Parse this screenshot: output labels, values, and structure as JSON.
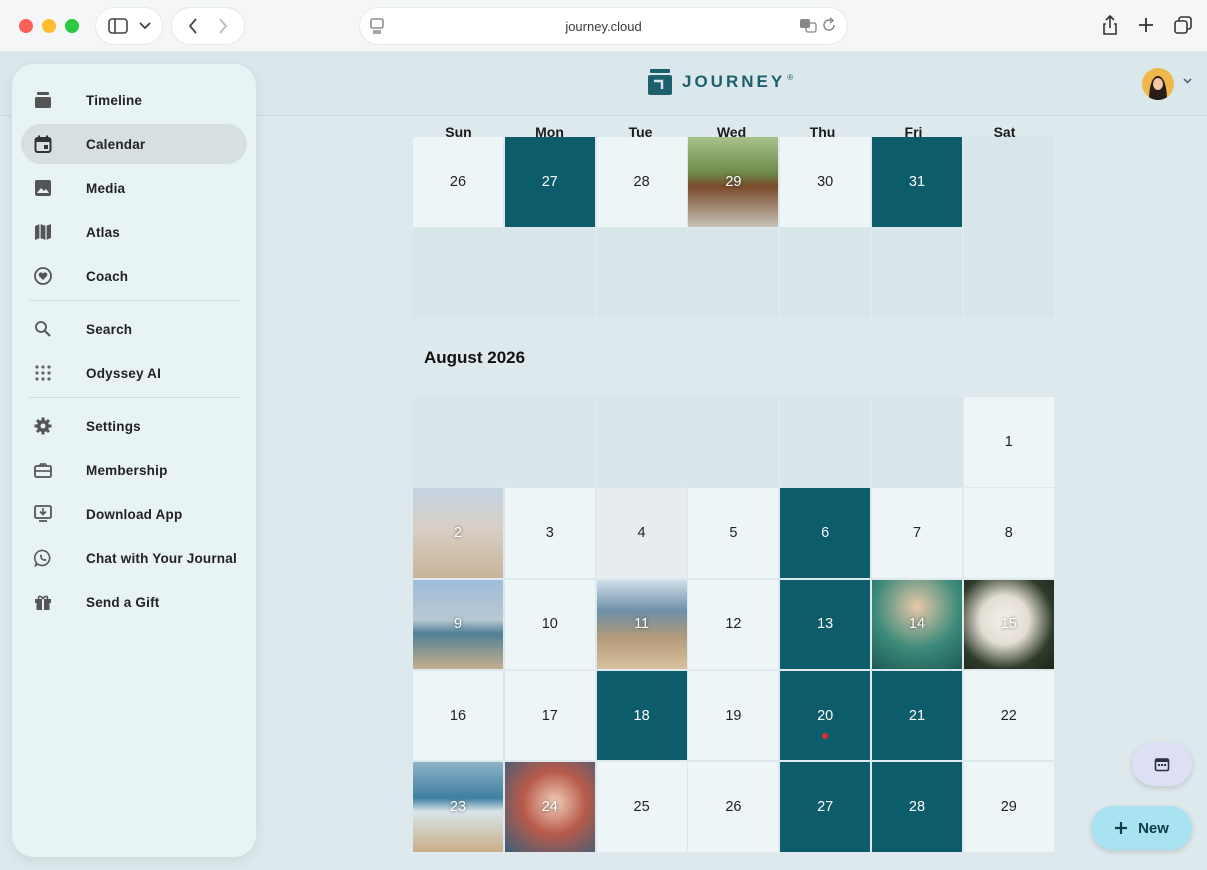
{
  "browser": {
    "url": "journey.cloud"
  },
  "app": {
    "brand": "JOURNEY",
    "brand_mark": "®"
  },
  "sidebar": {
    "items": [
      {
        "label": "Timeline",
        "icon": "timeline-icon"
      },
      {
        "label": "Calendar",
        "icon": "calendar-icon",
        "active": true
      },
      {
        "label": "Media",
        "icon": "image-icon"
      },
      {
        "label": "Atlas",
        "icon": "map-icon"
      },
      {
        "label": "Coach",
        "icon": "heart-icon"
      },
      {
        "label": "Search",
        "icon": "search-icon"
      },
      {
        "label": "Odyssey AI",
        "icon": "dots-grid-icon"
      },
      {
        "label": "Settings",
        "icon": "gear-icon"
      },
      {
        "label": "Membership",
        "icon": "membership-card-icon"
      },
      {
        "label": "Download App",
        "icon": "download-monitor-icon"
      },
      {
        "label": "Chat with Your Journal",
        "icon": "whatsapp-icon"
      },
      {
        "label": "Send a Gift",
        "icon": "gift-icon"
      }
    ]
  },
  "calendar": {
    "weekdays": [
      "Sun",
      "Mon",
      "Tue",
      "Wed",
      "Thu",
      "Fri",
      "Sat"
    ],
    "july_tail": [
      {
        "day": "26",
        "style": "plain"
      },
      {
        "day": "27",
        "style": "teal"
      },
      {
        "day": "28",
        "style": "plain"
      },
      {
        "day": "29",
        "style": "photo-horse"
      },
      {
        "day": "30",
        "style": "plain"
      },
      {
        "day": "31",
        "style": "teal"
      },
      {
        "day": "",
        "style": "empty"
      }
    ],
    "month_title": "August 2026",
    "august": [
      {
        "day": "",
        "style": "empty"
      },
      {
        "day": "",
        "style": "empty"
      },
      {
        "day": "",
        "style": "empty"
      },
      {
        "day": "",
        "style": "empty"
      },
      {
        "day": "",
        "style": "empty"
      },
      {
        "day": "",
        "style": "empty"
      },
      {
        "day": "1",
        "style": "plain"
      },
      {
        "day": "2",
        "style": "photo-beach"
      },
      {
        "day": "3",
        "style": "plain"
      },
      {
        "day": "4",
        "style": "grayish"
      },
      {
        "day": "5",
        "style": "plain"
      },
      {
        "day": "6",
        "style": "teal"
      },
      {
        "day": "7",
        "style": "plain"
      },
      {
        "day": "8",
        "style": "plain"
      },
      {
        "day": "9",
        "style": "photo-girl"
      },
      {
        "day": "10",
        "style": "plain"
      },
      {
        "day": "11",
        "style": "photo-shore"
      },
      {
        "day": "12",
        "style": "plain"
      },
      {
        "day": "13",
        "style": "teal"
      },
      {
        "day": "14",
        "style": "photo-icecream"
      },
      {
        "day": "15",
        "style": "photo-dog"
      },
      {
        "day": "16",
        "style": "plain"
      },
      {
        "day": "17",
        "style": "plain"
      },
      {
        "day": "18",
        "style": "teal"
      },
      {
        "day": "19",
        "style": "plain"
      },
      {
        "day": "20",
        "style": "teal",
        "dot": true
      },
      {
        "day": "21",
        "style": "teal"
      },
      {
        "day": "22",
        "style": "plain"
      },
      {
        "day": "23",
        "style": "photo-wave"
      },
      {
        "day": "24",
        "style": "photo-kids"
      },
      {
        "day": "25",
        "style": "plain"
      },
      {
        "day": "26",
        "style": "plain"
      },
      {
        "day": "27",
        "style": "teal"
      },
      {
        "day": "28",
        "style": "teal"
      },
      {
        "day": "29",
        "style": "plain"
      }
    ]
  },
  "fab": {
    "new_label": "New"
  },
  "colors": {
    "accent_teal": "#0c5c6b",
    "new_button": "#a9e3f2",
    "calendar_button": "#dde0f5"
  }
}
